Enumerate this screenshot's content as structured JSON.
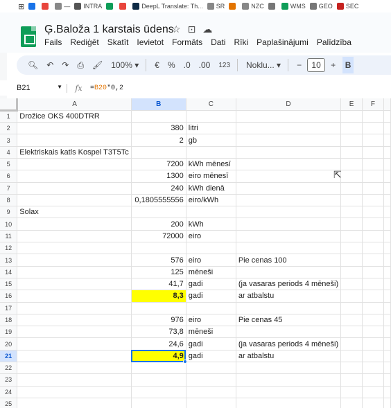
{
  "bookmarks": [
    {
      "label": "",
      "color": "#1a73e8"
    },
    {
      "label": "",
      "color": "#e8453c"
    },
    {
      "label": "—",
      "color": "#888888"
    },
    {
      "label": "INTRA",
      "color": "#555555"
    },
    {
      "label": "",
      "color": "#0f9d58"
    },
    {
      "label": "",
      "color": "#e8453c"
    },
    {
      "label": "DeepL Translate: Th...",
      "color": "#0f2b46"
    },
    {
      "label": "SR",
      "color": "#888888"
    },
    {
      "label": "",
      "color": "#e37400"
    },
    {
      "label": "NZC",
      "color": "#888888"
    },
    {
      "label": "",
      "color": "#777777"
    },
    {
      "label": "WMS",
      "color": "#0f9d58"
    },
    {
      "label": "GEO",
      "color": "#777777"
    },
    {
      "label": "SEC",
      "color": "#c5221f"
    }
  ],
  "doc": {
    "title": "Ģ.Baloža 1 karstais ūdens",
    "menu": [
      "Fails",
      "Rediģēt",
      "Skatīt",
      "Ievietot",
      "Formāts",
      "Dati",
      "Rīki",
      "Paplašinājumi",
      "Palīdzība"
    ]
  },
  "toolbar": {
    "zoom": "100%",
    "currency": "€",
    "percent": "%",
    "dec_decrease": ".0",
    "dec_increase": ".00",
    "format_123": "123",
    "font": "Noklu...",
    "font_size": "10",
    "minus": "−",
    "plus": "+",
    "bold": "B"
  },
  "formula_bar": {
    "cell_ref": "B21",
    "fx": "fx",
    "formula_prefix": "=",
    "formula_ref": "B20",
    "formula_rest": "*0,2"
  },
  "grid": {
    "columns": [
      "A",
      "B",
      "C",
      "D",
      "E",
      "F"
    ],
    "selected_column": "B",
    "selected_row": 21,
    "rows": [
      {
        "n": "1",
        "a": "Drožice OKS 400DTRR",
        "b": "",
        "c": "",
        "d": ""
      },
      {
        "n": "2",
        "a": "",
        "b": "380",
        "c": "litri",
        "d": ""
      },
      {
        "n": "3",
        "a": "",
        "b": "2",
        "c": "gb",
        "d": ""
      },
      {
        "n": "4",
        "a": "Elektriskais katls Kospel T3T5Tc",
        "b": "",
        "c": "",
        "d": ""
      },
      {
        "n": "5",
        "a": "",
        "b": "7200",
        "c": "kWh mēnesī",
        "d": ""
      },
      {
        "n": "6",
        "a": "",
        "b": "1300",
        "c": "eiro mēnesī",
        "d": ""
      },
      {
        "n": "7",
        "a": "",
        "b": "240",
        "c": "kWh dienā",
        "d": ""
      },
      {
        "n": "8",
        "a": "",
        "b": "0,1805555556",
        "c": "eiro/kWh",
        "d": ""
      },
      {
        "n": "9",
        "a": "Solax",
        "b": "",
        "c": "",
        "d": ""
      },
      {
        "n": "10",
        "a": "",
        "b": "200",
        "c": "kWh",
        "d": ""
      },
      {
        "n": "11",
        "a": "",
        "b": "72000",
        "c": "eiro",
        "d": ""
      },
      {
        "n": "12",
        "a": "",
        "b": "",
        "c": "",
        "d": ""
      },
      {
        "n": "13",
        "a": "",
        "b": "576",
        "c": "eiro",
        "d": "Pie cenas 100"
      },
      {
        "n": "14",
        "a": "",
        "b": "125",
        "c": "mēneši",
        "d": ""
      },
      {
        "n": "15",
        "a": "",
        "b": "41,7",
        "c": "gadi",
        "d": "(ja vasaras periods 4 mēneši)"
      },
      {
        "n": "16",
        "a": "",
        "b": "8,3",
        "c": "gadi",
        "d": "ar atbalstu"
      },
      {
        "n": "17",
        "a": "",
        "b": "",
        "c": "",
        "d": ""
      },
      {
        "n": "18",
        "a": "",
        "b": "976",
        "c": "eiro",
        "d": "Pie cenas 45"
      },
      {
        "n": "19",
        "a": "",
        "b": "73,8",
        "c": "mēneši",
        "d": ""
      },
      {
        "n": "20",
        "a": "",
        "b": "24,6",
        "c": "gadi",
        "d": "(ja vasaras periods 4 mēneši)"
      },
      {
        "n": "21",
        "a": "",
        "b": "4,9",
        "c": "gadi",
        "d": "ar atbalstu"
      },
      {
        "n": "22",
        "a": "",
        "b": "",
        "c": "",
        "d": ""
      },
      {
        "n": "23",
        "a": "",
        "b": "",
        "c": "",
        "d": ""
      },
      {
        "n": "24",
        "a": "",
        "b": "",
        "c": "",
        "d": ""
      },
      {
        "n": "25",
        "a": "",
        "b": "",
        "c": "",
        "d": ""
      }
    ]
  },
  "colors": {
    "highlight": "#ffff00",
    "selection": "#1a73e8",
    "header_selected": "#d3e3fd"
  }
}
